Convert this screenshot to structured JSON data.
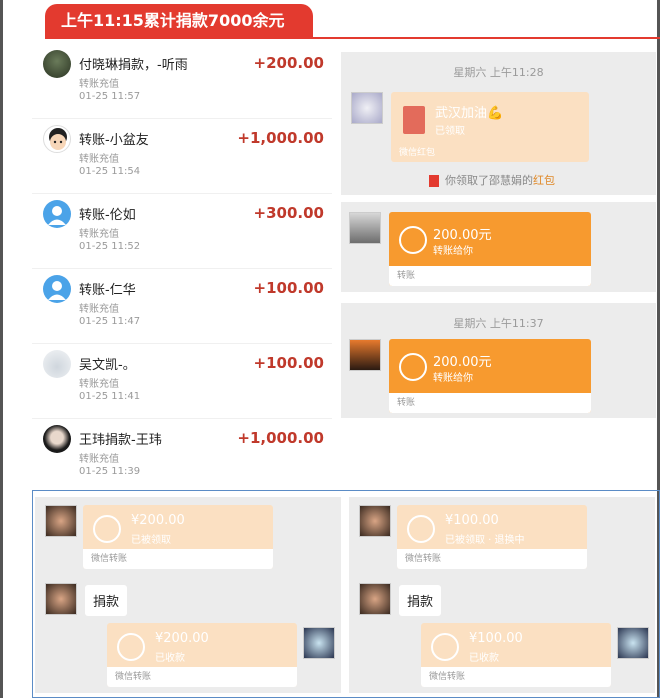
{
  "header": {
    "title": "上午11:15累计捐款7000余元"
  },
  "donations": [
    {
      "name": "付晓琳捐款，-听雨",
      "amount": "+200.00",
      "sub": "转账充值",
      "time": "01-25  11:57"
    },
    {
      "name": "转账-小盆友",
      "amount": "+1,000.00",
      "sub": "转账充值",
      "time": "01-25  11:54"
    },
    {
      "name": "转账-伦如",
      "amount": "+300.00",
      "sub": "转账充值",
      "time": "01-25  11:52"
    },
    {
      "name": "转账-仁华",
      "amount": "+100.00",
      "sub": "转账充值",
      "time": "01-25  11:47"
    },
    {
      "name": "吴文凯-。",
      "amount": "+100.00",
      "sub": "转账充值",
      "time": "01-25  11:41"
    },
    {
      "name": "王玮捐款-王玮",
      "amount": "+1,000.00",
      "sub": "转账充值",
      "time": "01-25  11:39"
    }
  ],
  "chat1": {
    "timestamp": "星期六 上午11:28",
    "redpacket_title": "武汉加油💪",
    "redpacket_status": "已领取",
    "redpacket_footer": "微信红包",
    "notice_prefix": "你领取了邵慧娟的",
    "notice_link": "红包"
  },
  "chat2": {
    "amount": "200.00元",
    "note": "转账给你",
    "footer": "转账"
  },
  "chat3": {
    "timestamp": "星期六 上午11:37",
    "amount": "200.00元",
    "note": "转账给你",
    "footer": "转账"
  },
  "bottom_left": {
    "card1_amount": "¥200.00",
    "card1_note": "已被领取",
    "card1_footer": "微信转账",
    "message": "捐款",
    "card2_amount": "¥200.00",
    "card2_note": "已收款",
    "card2_footer": "微信转账"
  },
  "bottom_right": {
    "card1_amount": "¥100.00",
    "card1_note": "已被领取 · 退换中",
    "card1_footer": "微信转账",
    "message": "捐款",
    "card2_amount": "¥100.00",
    "card2_note": "已收款",
    "card2_footer": "微信转账"
  },
  "colors": {
    "accent_red": "#e33a2f",
    "amount_red": "#c0392b",
    "transfer_orange": "#f79a2f",
    "faded_orange": "#fbe0c2"
  }
}
